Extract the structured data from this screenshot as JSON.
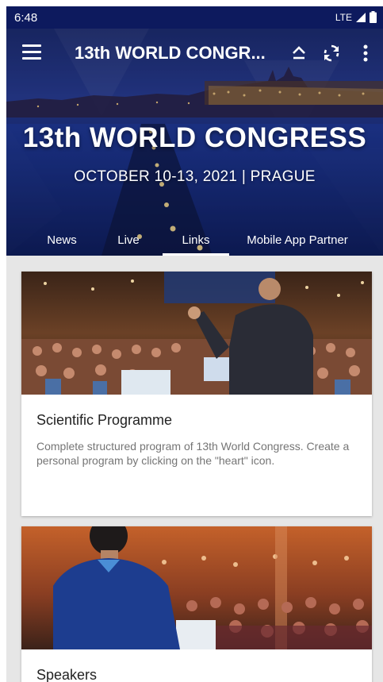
{
  "status_bar": {
    "time": "6:48",
    "network": "LTE"
  },
  "app_bar": {
    "title": "13th WORLD CONGR..."
  },
  "hero": {
    "headline": "13th WORLD CONGRESS",
    "subline": "OCTOBER 10-13, 2021 | PRAGUE"
  },
  "tabs": [
    {
      "label": "News"
    },
    {
      "label": "Live"
    },
    {
      "label": "Links"
    },
    {
      "label": "Mobile App Partner"
    }
  ],
  "selected_tab": "Links",
  "cards": [
    {
      "title": "Scientific Programme",
      "description": "Complete structured program of 13th World Congress. Create a personal program by clicking on the \"heart\" icon."
    },
    {
      "title": "Speakers"
    }
  ],
  "colors": {
    "status_bar": "#0d1a5e",
    "hero_blue": "#22378a",
    "background": "#e6e6e6"
  }
}
